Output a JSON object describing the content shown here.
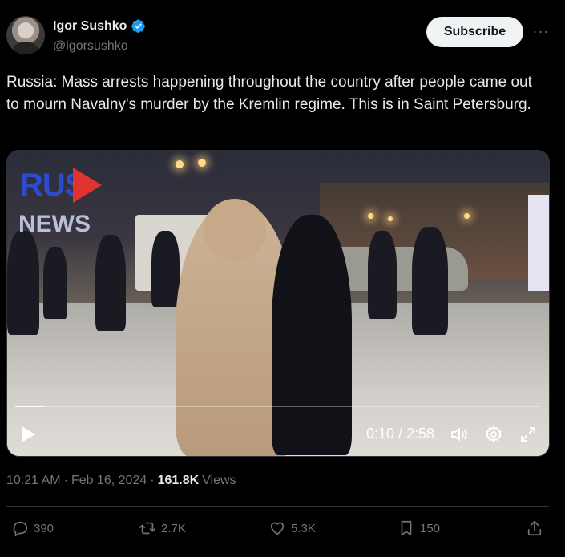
{
  "author": {
    "display_name": "Igor Sushko",
    "handle": "@igorsushko",
    "verified_icon": "verified-badge-icon"
  },
  "header": {
    "subscribe_label": "Subscribe",
    "more_label": "···"
  },
  "tweet": {
    "text": "Russia: Mass arrests happening throughout the country after people came out to mourn Navalny's murder by the Kremlin regime. This is in Saint Petersburg."
  },
  "video": {
    "watermark_top": "RUS",
    "watermark_bottom": "NEWS",
    "time_display": "0:10 / 2:58",
    "progress_fraction": 0.056,
    "icons": [
      "play-icon",
      "volume-icon",
      "settings-icon",
      "fullscreen-icon"
    ]
  },
  "meta": {
    "time": "10:21 AM",
    "date": "Feb 16, 2024",
    "separator": "·",
    "views_count": "161.8K",
    "views_label": "Views"
  },
  "actions": {
    "replies": "390",
    "reposts": "2.7K",
    "likes": "5.3K",
    "bookmarks": "150"
  },
  "colors": {
    "background": "#000000",
    "text": "#e7e9ea",
    "muted": "#71767b",
    "verified": "#1d9bf0",
    "subscribe_bg": "#eff3f4"
  }
}
